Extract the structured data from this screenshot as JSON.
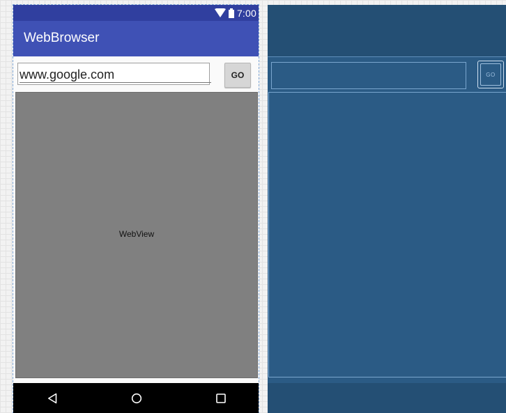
{
  "status_bar": {
    "time": "7:00",
    "wifi_icon": "wifi-icon",
    "battery_icon": "battery-icon"
  },
  "app_bar": {
    "title": "WebBrowser"
  },
  "url_bar": {
    "value": "www.google.com",
    "go_label": "GO"
  },
  "webview": {
    "label": "WebView"
  },
  "nav_bar": {
    "back_icon": "back-triangle-icon",
    "home_icon": "home-circle-icon",
    "recents_icon": "recents-square-icon"
  },
  "blueprint": {
    "go_label": "GO"
  },
  "colors": {
    "status_bar": "#303f9f",
    "app_bar": "#3f51b5",
    "webview": "#808080",
    "blueprint": "#2b5b85"
  }
}
